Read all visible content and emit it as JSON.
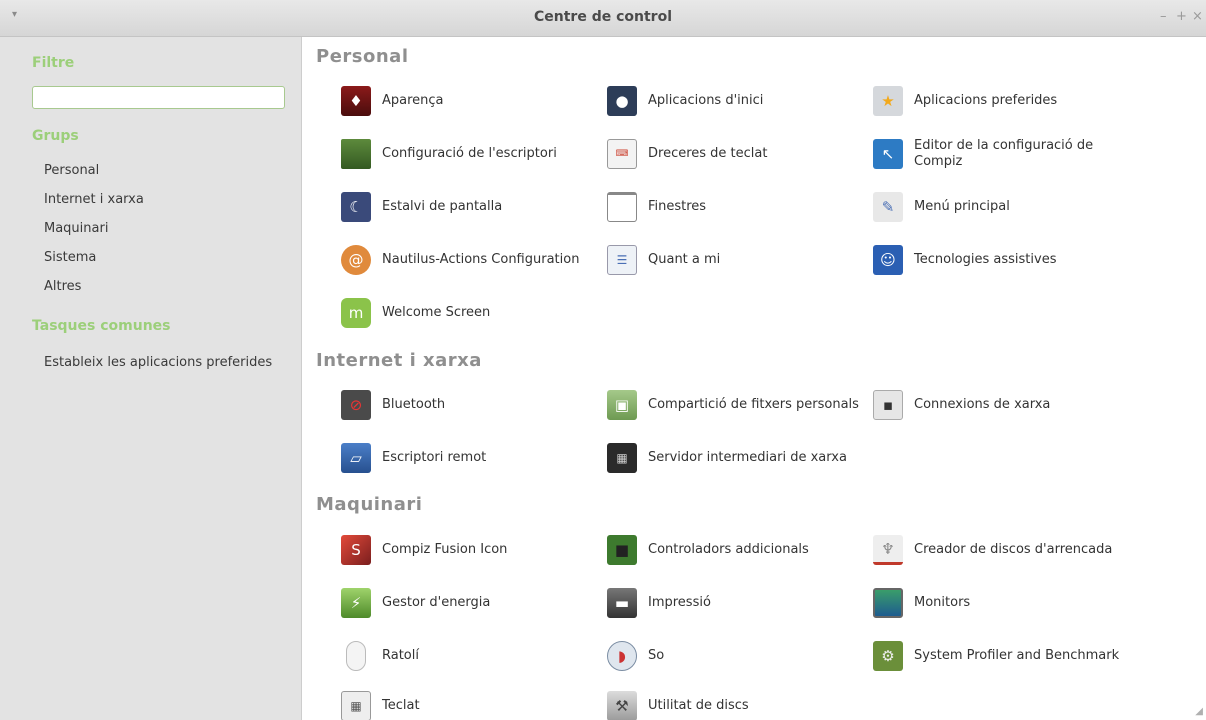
{
  "window": {
    "title": "Centre de control",
    "menu_glyph": "▾",
    "minimize_glyph": "–",
    "maximize_glyph": "+",
    "close_glyph": "×"
  },
  "sidebar": {
    "filter_heading": "Filtre",
    "search_value": "",
    "groups_heading": "Grups",
    "groups": [
      "Personal",
      "Internet i xarxa",
      "Maquinari",
      "Sistema",
      "Altres"
    ],
    "tasks_heading": "Tasques comunes",
    "tasks": [
      "Estableix les aplicacions preferides"
    ]
  },
  "main": {
    "personal": {
      "title": "Personal",
      "items": [
        {
          "label": "Aparença",
          "icon": "appearance-icon"
        },
        {
          "label": "Aplicacions d'inici",
          "icon": "startup-apps-icon"
        },
        {
          "label": "Aplicacions preferides",
          "icon": "preferred-apps-icon"
        },
        {
          "label": "Configuració de l'escriptori",
          "icon": "desktop-settings-icon"
        },
        {
          "label": "Dreceres de teclat",
          "icon": "keyboard-shortcuts-icon"
        },
        {
          "label": "Editor de la configuració de Compiz",
          "icon": "compiz-config-icon"
        },
        {
          "label": "Estalvi de pantalla",
          "icon": "screensaver-icon"
        },
        {
          "label": "Finestres",
          "icon": "windows-icon"
        },
        {
          "label": "Menú principal",
          "icon": "main-menu-icon"
        },
        {
          "label": "Nautilus-Actions Configuration",
          "icon": "nautilus-actions-icon"
        },
        {
          "label": "Quant a mi",
          "icon": "about-me-icon"
        },
        {
          "label": "Tecnologies assistives",
          "icon": "accessibility-icon"
        },
        {
          "label": "Welcome Screen",
          "icon": "mint-welcome-icon"
        }
      ]
    },
    "internet": {
      "title": "Internet i xarxa",
      "items": [
        {
          "label": "Bluetooth",
          "icon": "bluetooth-icon"
        },
        {
          "label": "Compartició de fitxers personals",
          "icon": "file-sharing-icon"
        },
        {
          "label": "Connexions de xarxa",
          "icon": "network-connections-icon"
        },
        {
          "label": "Escriptori remot",
          "icon": "remote-desktop-icon"
        },
        {
          "label": "Servidor intermediari de xarxa",
          "icon": "network-proxy-icon"
        }
      ]
    },
    "hardware": {
      "title": "Maquinari",
      "items": [
        {
          "label": "Compiz Fusion Icon",
          "icon": "compiz-fusion-icon"
        },
        {
          "label": "Controladors addicionals",
          "icon": "additional-drivers-icon"
        },
        {
          "label": "Creador de discos d'arrencada",
          "icon": "startup-disk-creator-icon"
        },
        {
          "label": "Gestor d'energia",
          "icon": "power-manager-icon"
        },
        {
          "label": "Impressió",
          "icon": "printer-icon"
        },
        {
          "label": "Monitors",
          "icon": "monitors-icon"
        },
        {
          "label": "Ratolí",
          "icon": "mouse-icon"
        },
        {
          "label": "So",
          "icon": "sound-icon"
        },
        {
          "label": "System Profiler and Benchmark",
          "icon": "system-profiler-icon"
        },
        {
          "label": "Teclat",
          "icon": "keyboard-icon"
        },
        {
          "label": "Utilitat de discs",
          "icon": "disk-utility-icon"
        }
      ]
    }
  },
  "colors": {
    "sidebar_heading": "#9ccf7a",
    "category_title": "#8f8f8f",
    "sidebar_bg": "#e3e3e3"
  }
}
